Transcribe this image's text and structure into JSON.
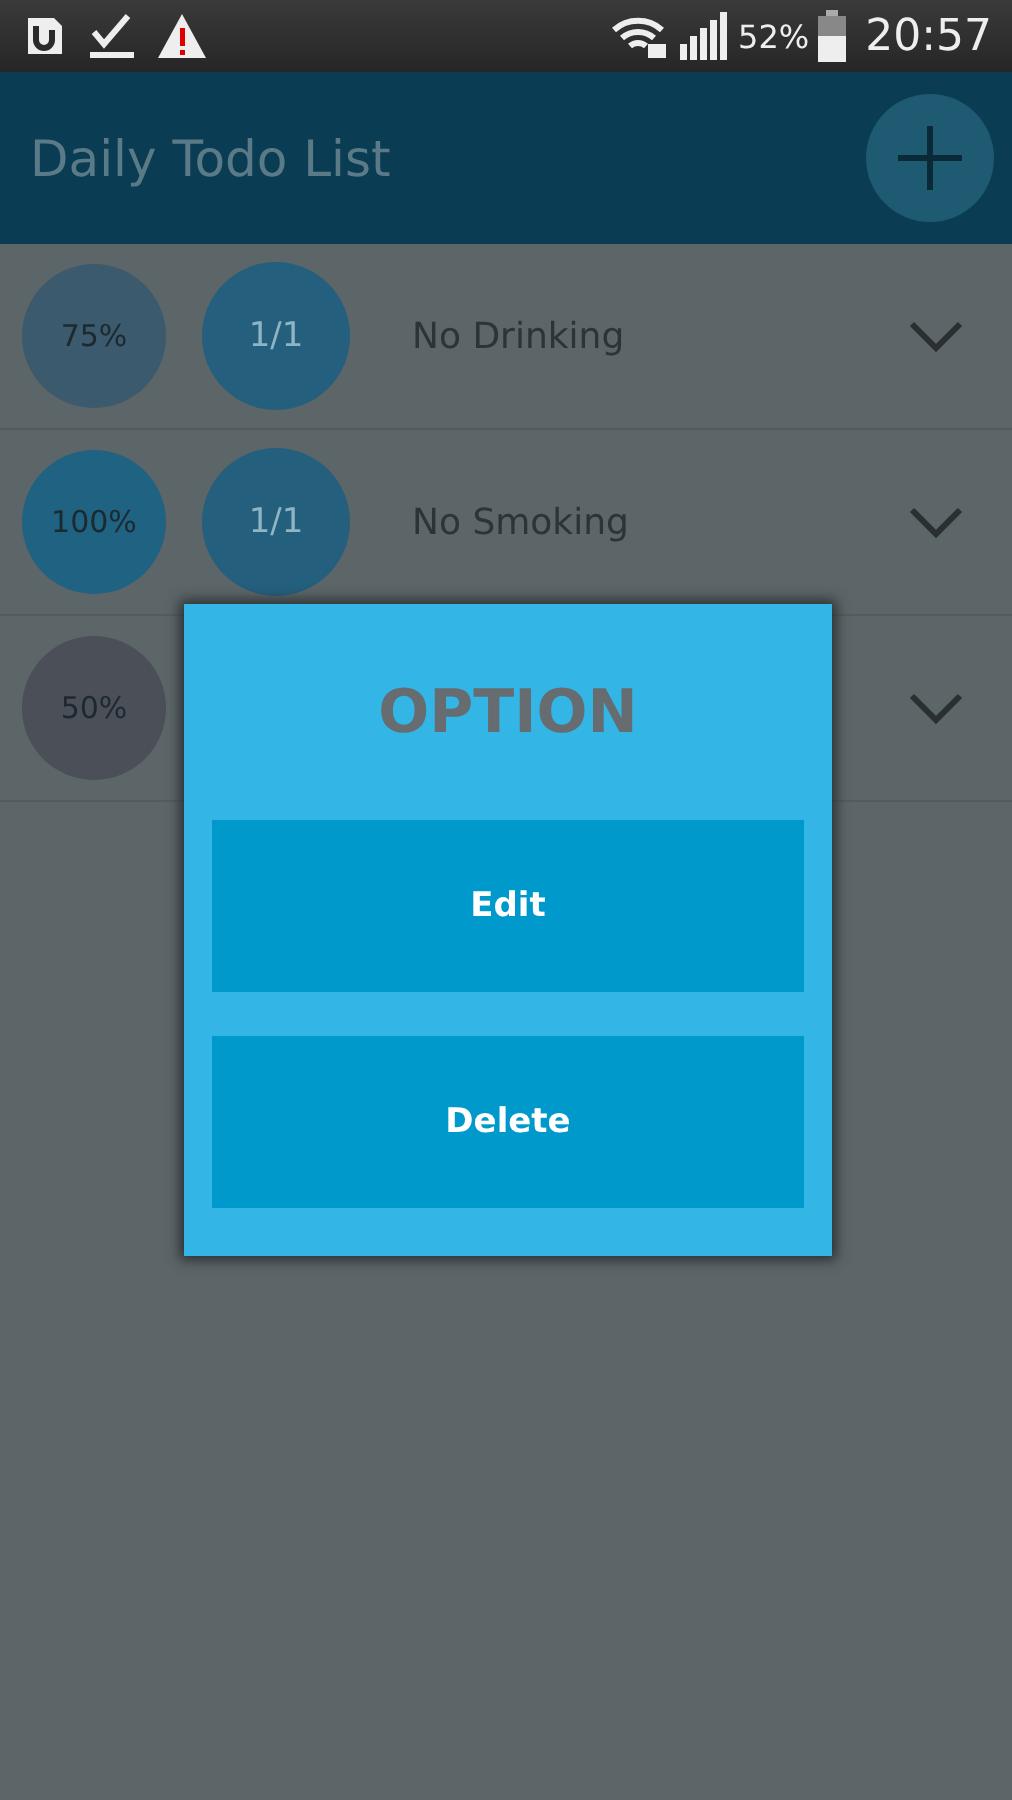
{
  "status_bar": {
    "battery": "52%",
    "time": "20:57"
  },
  "app_bar": {
    "title": "Daily Todo List"
  },
  "todos": [
    {
      "percent": "75%",
      "color": "#3b5a6e",
      "count": "1/1",
      "title": "No Drinking"
    },
    {
      "percent": "100%",
      "color": "#1f6282",
      "count": "1/1",
      "title": "No Smoking"
    },
    {
      "percent": "50%",
      "color": "#4b4f58"
    }
  ],
  "dialog": {
    "title": "OPTION",
    "buttons": [
      "Edit",
      "Delete"
    ]
  }
}
